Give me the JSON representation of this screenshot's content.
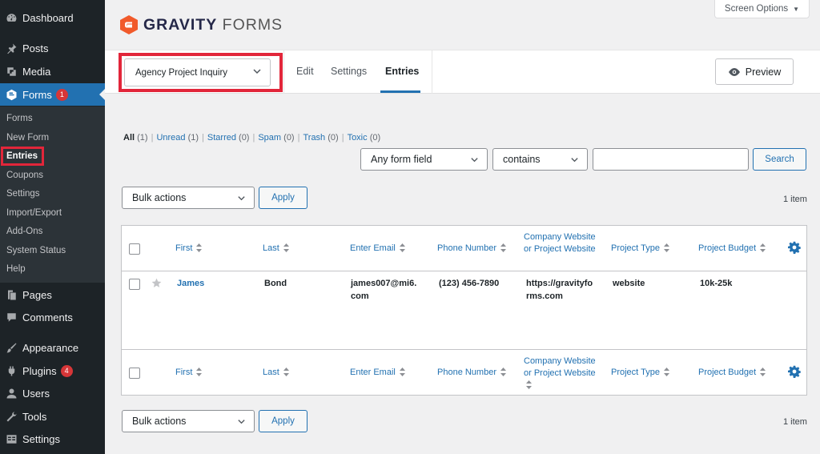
{
  "sidebar": {
    "items": [
      {
        "label": "Dashboard",
        "icon": "dashboard-icon"
      },
      {
        "label": "Posts",
        "icon": "pin-icon"
      },
      {
        "label": "Media",
        "icon": "media-icon"
      },
      {
        "label": "Forms",
        "icon": "gravity-forms-icon",
        "badge": "1"
      },
      {
        "label": "Pages",
        "icon": "pages-icon"
      },
      {
        "label": "Comments",
        "icon": "comment-icon"
      },
      {
        "label": "Appearance",
        "icon": "brush-icon"
      },
      {
        "label": "Plugins",
        "icon": "plug-icon",
        "badge": "4"
      },
      {
        "label": "Users",
        "icon": "users-icon"
      },
      {
        "label": "Tools",
        "icon": "wrench-icon"
      },
      {
        "label": "Settings",
        "icon": "settings-icon"
      }
    ],
    "submenu": [
      "Forms",
      "New Form",
      "Entries",
      "Coupons",
      "Settings",
      "Import/Export",
      "Add-Ons",
      "System Status",
      "Help"
    ]
  },
  "header": {
    "logo_bold": "GRAVITY",
    "logo_light": "FORMS",
    "screen_options": "Screen Options"
  },
  "toolbar": {
    "form_name": "Agency Project Inquiry",
    "tabs": [
      "Edit",
      "Settings",
      "Entries"
    ],
    "preview": "Preview"
  },
  "filters": {
    "links": [
      {
        "label": "All",
        "count": "(1)"
      },
      {
        "label": "Unread",
        "count": "(1)"
      },
      {
        "label": "Starred",
        "count": "(0)"
      },
      {
        "label": "Spam",
        "count": "(0)"
      },
      {
        "label": "Trash",
        "count": "(0)"
      },
      {
        "label": "Toxic",
        "count": "(0)"
      }
    ],
    "field_select": "Any form field",
    "operator_select": "contains",
    "search_value": "",
    "search_button": "Search"
  },
  "bulk": {
    "label": "Bulk actions",
    "apply": "Apply",
    "items_count": "1 item"
  },
  "table": {
    "headers": [
      "First",
      "Last",
      "Enter Email",
      "Phone Number",
      "Company Website",
      "or Project Website",
      "Project Type",
      "Project Budget"
    ],
    "row": {
      "first": "James",
      "last": "Bond",
      "email_l1": "james007@mi6.",
      "email_l2": "com",
      "phone": "(123) 456-7890",
      "website_l1": "https://gravityfo",
      "website_l2": "rms.com",
      "project_type": "website",
      "budget": "10k-25k"
    }
  },
  "colors": {
    "sidebar_bg": "#1d2327",
    "active": "#2271b1",
    "highlight": "#e2263a",
    "logo_orange": "#f15a2b"
  }
}
